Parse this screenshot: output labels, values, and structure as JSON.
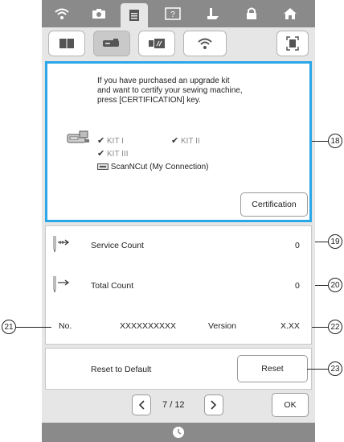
{
  "certification": {
    "message_line1": "If you have purchased an upgrade kit",
    "message_line2": "and want to certify your sewing machine,",
    "message_line3": "press [CERTIFICATION] key.",
    "kit1": "KIT I",
    "kit2": "KIT II",
    "kit3": "KIT III",
    "scanncut": "ScanNCut (My Connection)",
    "button": "Certification"
  },
  "counts": {
    "service_label": "Service Count",
    "service_value": "0",
    "total_label": "Total Count",
    "total_value": "0",
    "no_label": "No.",
    "no_value": "XXXXXXXXXX",
    "version_label": "Version",
    "version_value": "X.XX"
  },
  "reset": {
    "label": "Reset to Default",
    "button": "Reset"
  },
  "pagination": {
    "current": "7",
    "separator": "/",
    "total": "12",
    "ok": "OK"
  },
  "callouts": {
    "c18": "18",
    "c19": "19",
    "c20": "20",
    "c21": "21",
    "c22": "22",
    "c23": "23"
  },
  "colors": {
    "accent": "#2aa7e8",
    "tabbar": "#8a8a8a"
  }
}
